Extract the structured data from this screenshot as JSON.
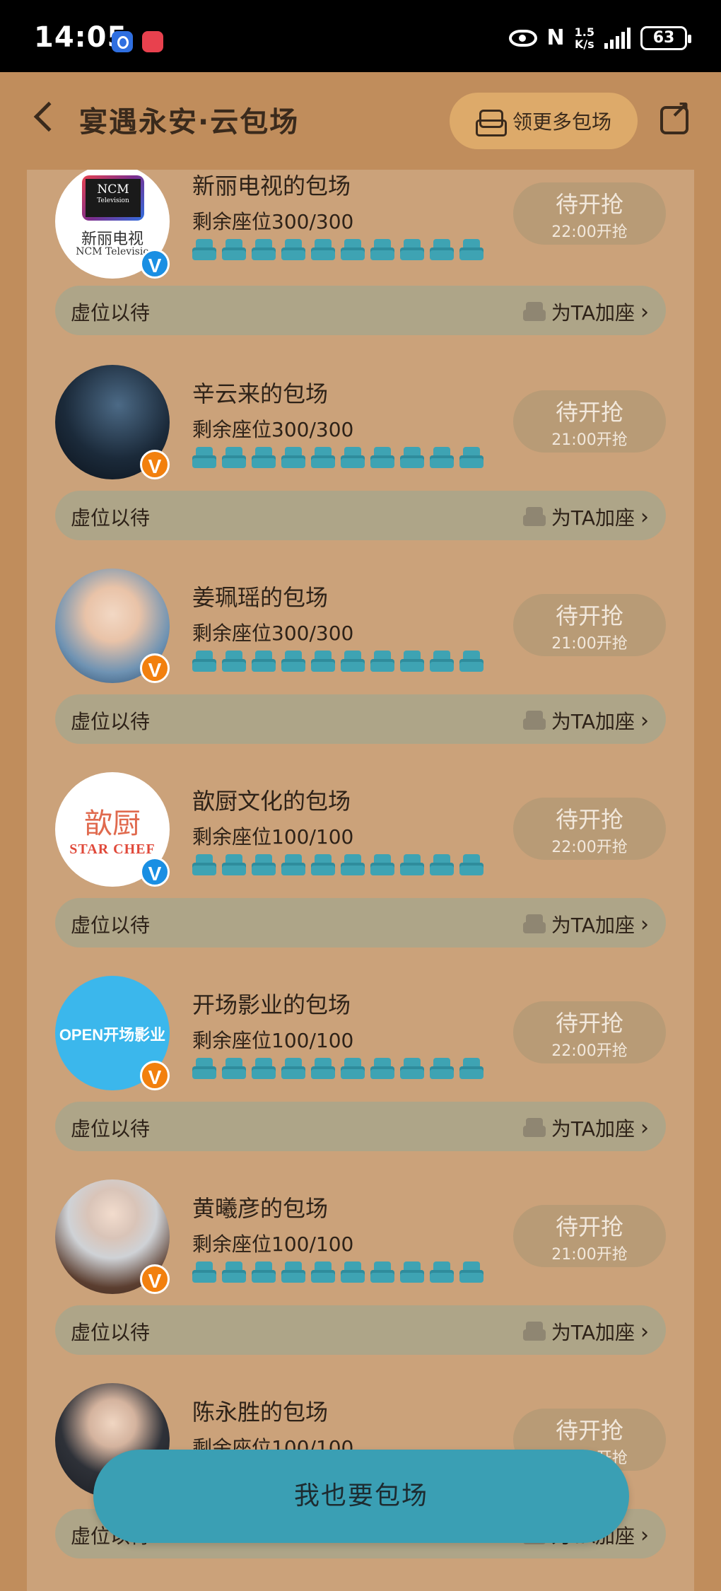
{
  "status_bar": {
    "time": "14:05",
    "net_speed": "1.5\nK/s",
    "nfc": "N",
    "battery": "63"
  },
  "header": {
    "title": "宴遇永安·云包场",
    "more_button": "领更多包场"
  },
  "rows": [
    {
      "name": "新丽电视的包场",
      "seats": "剩余座位300/300",
      "status": "待开抢",
      "open_time": "22:00开抢",
      "wait": "虚位以待",
      "add": "为TA加座",
      "avatar_text": "新丽电视",
      "avatar_sub": "NCM Televisio",
      "logo": "NCM",
      "logo_sub": "Television",
      "badge": "V"
    },
    {
      "name": "辛云来的包场",
      "seats": "剩余座位300/300",
      "status": "待开抢",
      "open_time": "21:00开抢",
      "wait": "虚位以待",
      "add": "为TA加座",
      "badge": "V"
    },
    {
      "name": "姜珮瑶的包场",
      "seats": "剩余座位300/300",
      "status": "待开抢",
      "open_time": "21:00开抢",
      "wait": "虚位以待",
      "add": "为TA加座",
      "badge": "V"
    },
    {
      "name": "歆厨文化的包场",
      "seats": "剩余座位100/100",
      "status": "待开抢",
      "open_time": "22:00开抢",
      "wait": "虚位以待",
      "add": "为TA加座",
      "avatar_text": "歆厨",
      "avatar_sub": "STAR CHEF",
      "badge": "V"
    },
    {
      "name": "开场影业的包场",
      "seats": "剩余座位100/100",
      "status": "待开抢",
      "open_time": "22:00开抢",
      "wait": "虚位以待",
      "add": "为TA加座",
      "avatar_text": "OPEN开场影业",
      "badge": "V"
    },
    {
      "name": "黄曦彦的包场",
      "seats": "剩余座位100/100",
      "status": "待开抢",
      "open_time": "21:00开抢",
      "wait": "虚位以待",
      "add": "为TA加座",
      "badge": "V"
    },
    {
      "name": "陈永胜的包场",
      "seats": "剩余座位100/100",
      "status": "待开抢",
      "open_time": "21:00开抢",
      "wait": "虚位以待",
      "add": "为TA加座",
      "badge": "V"
    }
  ],
  "float_button": "我也要包场",
  "colors": {
    "background": "#c08d5c",
    "panel": "#cba27a",
    "accent": "#3a9fb4",
    "seat": "#3ea3b3",
    "verified_blue": "#1a8fe3",
    "verified_orange": "#f2800e"
  }
}
